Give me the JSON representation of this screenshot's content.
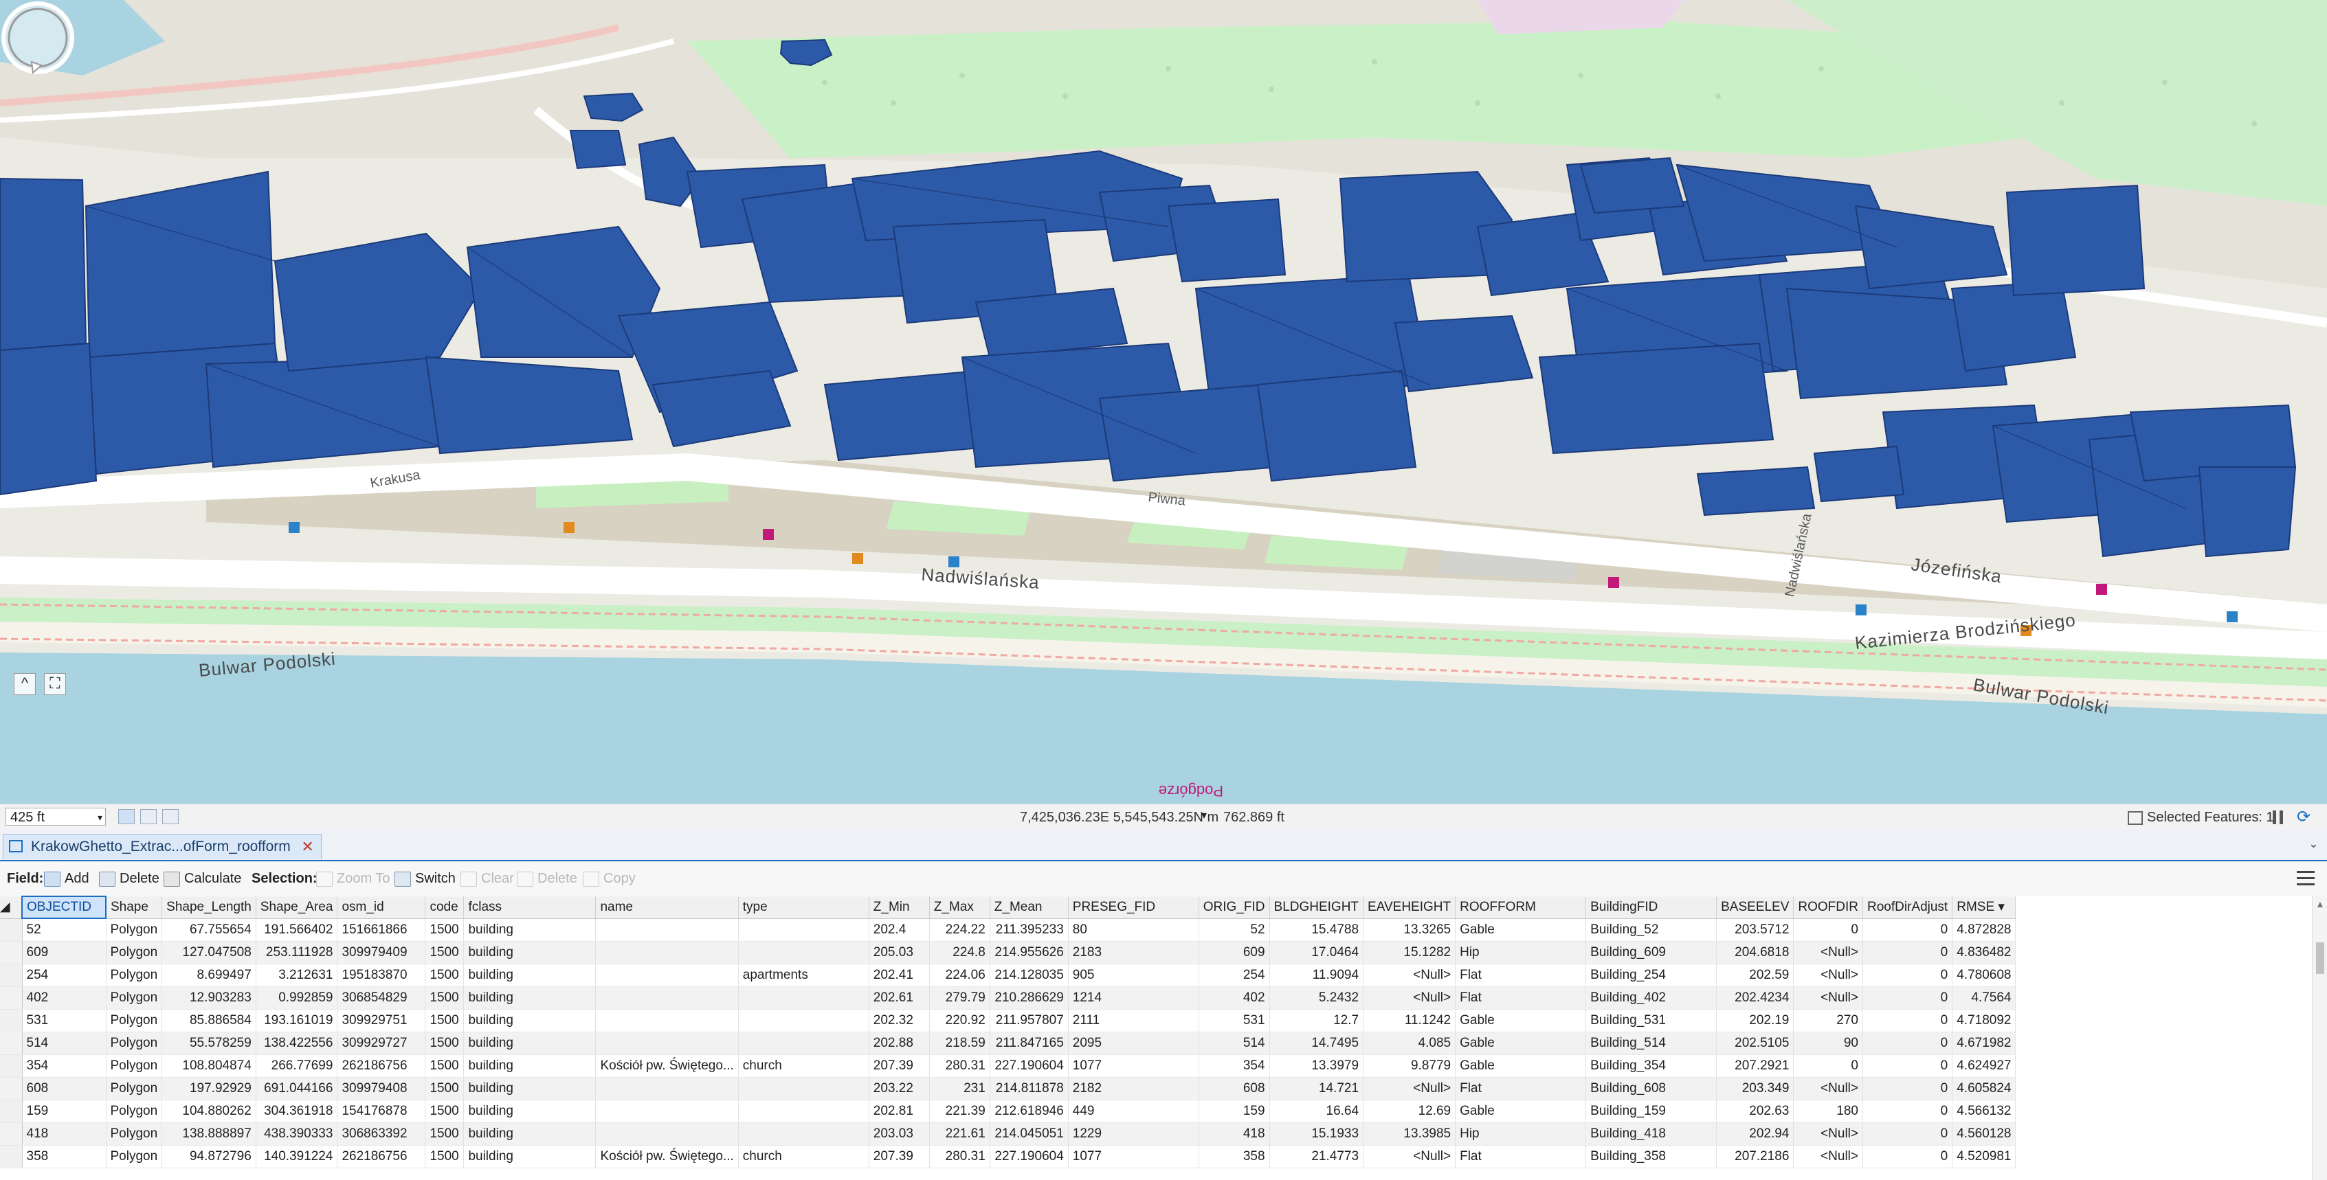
{
  "map": {
    "streets": [
      "Bulwar Podolski",
      "Nadwiślańska",
      "Józefińska",
      "Kazimierza Brodzińskiego",
      "Podgórze",
      "Piwna",
      "Krakusa",
      "Nadwiślańska"
    ],
    "colors": {
      "buildings": "#2d5aa8",
      "buildings_edge": "#1b3a7a",
      "river": "#a9d3e0",
      "park": "#c9f0c7",
      "ground": "#ecebe3",
      "road": "#ffffff"
    },
    "nav_icons": [
      "collapse-up-icon",
      "full-extent-icon",
      "navigator-compass-icon"
    ]
  },
  "statusbar": {
    "scale": "425 ft",
    "coordinates": "7,425,036.23E 5,545,543.25N m",
    "elevation": "762.869 ft",
    "selected_features": "Selected Features: 1"
  },
  "table_tab": {
    "title": "KrakowGhetto_Extrac...ofForm_roofform"
  },
  "toolbar": {
    "field_label": "Field:",
    "add": "Add",
    "delete": "Delete",
    "calculate": "Calculate",
    "selection_label": "Selection:",
    "zoom_to": "Zoom To",
    "switch": "Switch",
    "clear": "Clear",
    "sel_delete": "Delete",
    "copy": "Copy"
  },
  "table": {
    "columns": [
      "OBJECTID",
      "Shape",
      "Shape_Length",
      "Shape_Area",
      "osm_id",
      "code",
      "fclass",
      "name",
      "type",
      "Z_Min",
      "Z_Max",
      "Z_Mean",
      "PRESEG_FID",
      "ORIG_FID",
      "BLDGHEIGHT",
      "EAVEHEIGHT",
      "ROOFFORM",
      "BuildingFID",
      "BASEELEV",
      "ROOFDIR",
      "RoofDirAdjust",
      "RMSE"
    ],
    "sorted_column": "RMSE",
    "rows": [
      [
        "52",
        "Polygon",
        "67.755654",
        "191.566402",
        "151661866",
        "1500",
        "building",
        "",
        "",
        "202.4",
        "224.22",
        "211.395233",
        "80",
        "52",
        "15.4788",
        "13.3265",
        "Gable",
        "Building_52",
        "203.5712",
        "0",
        "0",
        "4.872828"
      ],
      [
        "609",
        "Polygon",
        "127.047508",
        "253.111928",
        "309979409",
        "1500",
        "building",
        "",
        "",
        "205.03",
        "224.8",
        "214.955626",
        "2183",
        "609",
        "17.0464",
        "15.1282",
        "Hip",
        "Building_609",
        "204.6818",
        "<Null>",
        "0",
        "4.836482"
      ],
      [
        "254",
        "Polygon",
        "8.699497",
        "3.212631",
        "195183870",
        "1500",
        "building",
        "",
        "apartments",
        "202.41",
        "224.06",
        "214.128035",
        "905",
        "254",
        "11.9094",
        "<Null>",
        "Flat",
        "Building_254",
        "202.59",
        "<Null>",
        "0",
        "4.780608"
      ],
      [
        "402",
        "Polygon",
        "12.903283",
        "0.992859",
        "306854829",
        "1500",
        "building",
        "",
        "",
        "202.61",
        "279.79",
        "210.286629",
        "1214",
        "402",
        "5.2432",
        "<Null>",
        "Flat",
        "Building_402",
        "202.4234",
        "<Null>",
        "0",
        "4.7564"
      ],
      [
        "531",
        "Polygon",
        "85.886584",
        "193.161019",
        "309929751",
        "1500",
        "building",
        "",
        "",
        "202.32",
        "220.92",
        "211.957807",
        "2111",
        "531",
        "12.7",
        "11.1242",
        "Gable",
        "Building_531",
        "202.19",
        "270",
        "0",
        "4.718092"
      ],
      [
        "514",
        "Polygon",
        "55.578259",
        "138.422556",
        "309929727",
        "1500",
        "building",
        "",
        "",
        "202.88",
        "218.59",
        "211.847165",
        "2095",
        "514",
        "14.7495",
        "4.085",
        "Gable",
        "Building_514",
        "202.5105",
        "90",
        "0",
        "4.671982"
      ],
      [
        "354",
        "Polygon",
        "108.804874",
        "266.77699",
        "262186756",
        "1500",
        "building",
        "Kościół pw. Świętego...",
        "church",
        "207.39",
        "280.31",
        "227.190604",
        "1077",
        "354",
        "13.3979",
        "9.8779",
        "Gable",
        "Building_354",
        "207.2921",
        "0",
        "0",
        "4.624927"
      ],
      [
        "608",
        "Polygon",
        "197.92929",
        "691.044166",
        "309979408",
        "1500",
        "building",
        "",
        "",
        "203.22",
        "231",
        "214.811878",
        "2182",
        "608",
        "14.721",
        "<Null>",
        "Flat",
        "Building_608",
        "203.349",
        "<Null>",
        "0",
        "4.605824"
      ],
      [
        "159",
        "Polygon",
        "104.880262",
        "304.361918",
        "154176878",
        "1500",
        "building",
        "",
        "",
        "202.81",
        "221.39",
        "212.618946",
        "449",
        "159",
        "16.64",
        "12.69",
        "Gable",
        "Building_159",
        "202.63",
        "180",
        "0",
        "4.566132"
      ],
      [
        "418",
        "Polygon",
        "138.888897",
        "438.390333",
        "306863392",
        "1500",
        "building",
        "",
        "",
        "203.03",
        "221.61",
        "214.045051",
        "1229",
        "418",
        "15.1933",
        "13.3985",
        "Hip",
        "Building_418",
        "202.94",
        "<Null>",
        "0",
        "4.560128"
      ],
      [
        "358",
        "Polygon",
        "94.872796",
        "140.391224",
        "262186756",
        "1500",
        "building",
        "Kościół pw. Świętego...",
        "church",
        "207.39",
        "280.31",
        "227.190604",
        "1077",
        "358",
        "21.4773",
        "<Null>",
        "Flat",
        "Building_358",
        "207.2186",
        "<Null>",
        "0",
        "4.520981"
      ]
    ]
  }
}
